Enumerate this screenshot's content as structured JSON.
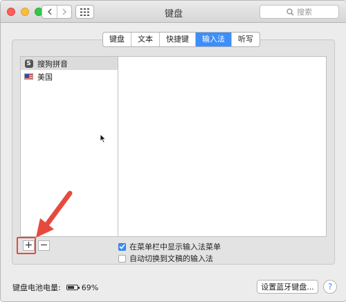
{
  "window": {
    "title": "键盘"
  },
  "toolbar": {
    "back_icon": "chevron-left-icon",
    "forward_icon": "chevron-right-icon",
    "grid_icon": "grid-icon"
  },
  "search": {
    "placeholder": "搜索"
  },
  "tabs": [
    {
      "label": "键盘",
      "active": false
    },
    {
      "label": "文本",
      "active": false
    },
    {
      "label": "快捷键",
      "active": false
    },
    {
      "label": "输入法",
      "active": true
    },
    {
      "label": "听写",
      "active": false
    }
  ],
  "input_sources": [
    {
      "label": "搜狗拼音",
      "icon": "sogou-s-icon",
      "selected": true
    },
    {
      "label": "美国",
      "icon": "us-flag-icon",
      "selected": false
    }
  ],
  "list_controls": {
    "add_label": "+",
    "remove_label": "−"
  },
  "options": {
    "show_in_menu": {
      "label": "在菜单栏中显示输入法菜单",
      "checked": true
    },
    "auto_switch": {
      "label": "自动切换到文稿的输入法",
      "checked": false
    }
  },
  "footer": {
    "battery_label": "键盘电池电量:",
    "battery_value": "69%",
    "bluetooth_button": "设置蓝牙键盘...",
    "help_label": "?"
  },
  "colors": {
    "accent": "#3d8ef8",
    "annotation": "#e64a3e"
  }
}
